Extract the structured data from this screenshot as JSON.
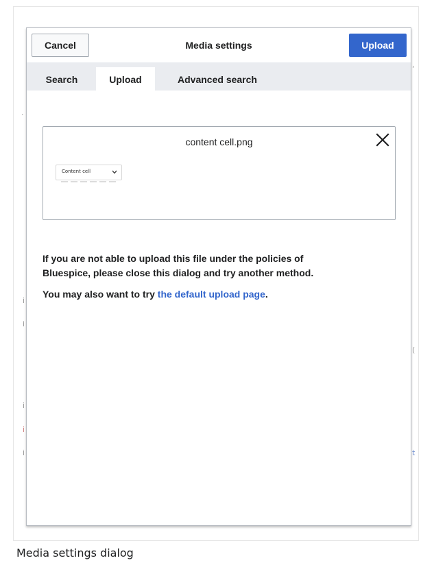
{
  "dialog": {
    "title": "Media settings",
    "cancel_label": "Cancel",
    "upload_label": "Upload"
  },
  "tabs": [
    {
      "label": "Search",
      "active": false
    },
    {
      "label": "Upload",
      "active": true
    },
    {
      "label": "Advanced search",
      "active": false
    }
  ],
  "file": {
    "name": "content cell.png",
    "thumbnail_select_label": "Content cell"
  },
  "notice": {
    "line1": "If you are not able to upload this file under the policies of",
    "line2": "Bluespice, please close this dialog and try another method.",
    "line3_prefix": "You may also want to try ",
    "link_text": "the default upload page",
    "line3_suffix": "."
  },
  "caption": "Media settings dialog",
  "colors": {
    "primary": "#3366cc",
    "tab_bar": "#eaecf0",
    "text": "#202122"
  },
  "icons": {
    "close": "close-icon",
    "chevron": "chevron-down-icon"
  }
}
